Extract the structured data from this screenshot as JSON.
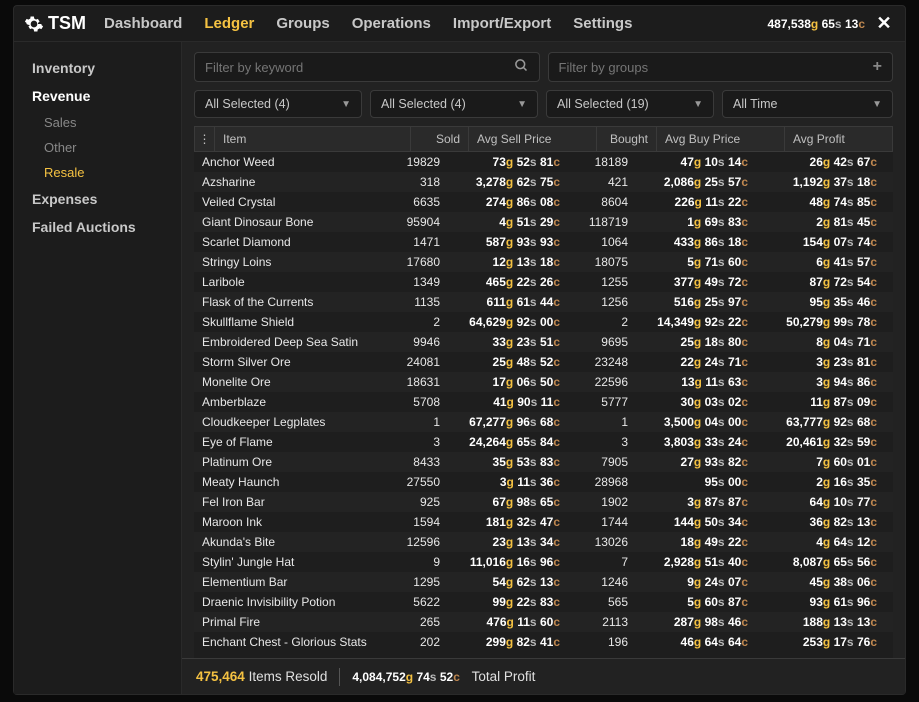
{
  "app": {
    "name": "TSM"
  },
  "nav": {
    "items": [
      "Dashboard",
      "Ledger",
      "Groups",
      "Operations",
      "Import/Export",
      "Settings"
    ],
    "active": "Ledger"
  },
  "wallet": {
    "g": "487,538",
    "s": "65",
    "c": "13"
  },
  "sidebar": {
    "items": [
      {
        "label": "Inventory",
        "type": "top"
      },
      {
        "label": "Revenue",
        "type": "top",
        "sel": true
      },
      {
        "label": "Sales",
        "type": "sub"
      },
      {
        "label": "Other",
        "type": "sub"
      },
      {
        "label": "Resale",
        "type": "sub",
        "sel": true
      },
      {
        "label": "Expenses",
        "type": "top"
      },
      {
        "label": "Failed Auctions",
        "type": "top"
      }
    ]
  },
  "filters": {
    "keyword_placeholder": "Filter by keyword",
    "groups_placeholder": "Filter by groups",
    "dd1": "All Selected (4)",
    "dd2": "All Selected (4)",
    "dd3": "All Selected (19)",
    "dd4": "All Time"
  },
  "columns": [
    "Item",
    "Sold",
    "Avg Sell Price",
    "Bought",
    "Avg Buy Price",
    "Avg Profit"
  ],
  "rows": [
    {
      "item": "Anchor Weed",
      "q": "q2",
      "sold": "19829",
      "asp": {
        "g": "73",
        "s": "52",
        "c": "81"
      },
      "bought": "18189",
      "abp": {
        "g": "47",
        "s": "10",
        "c": "14"
      },
      "prof": {
        "g": "26",
        "s": "42",
        "c": "67"
      }
    },
    {
      "item": "Azsharine",
      "q": "q4",
      "sold": "318",
      "asp": {
        "g": "3,278",
        "s": "62",
        "c": "75"
      },
      "bought": "421",
      "abp": {
        "g": "2,086",
        "s": "25",
        "c": "57"
      },
      "prof": {
        "g": "1,192",
        "s": "37",
        "c": "18"
      }
    },
    {
      "item": "Veiled Crystal",
      "q": "q4",
      "sold": "6635",
      "asp": {
        "g": "274",
        "s": "86",
        "c": "08"
      },
      "bought": "8604",
      "abp": {
        "g": "226",
        "s": "11",
        "c": "22"
      },
      "prof": {
        "g": "48",
        "s": "74",
        "c": "85"
      }
    },
    {
      "item": "Giant Dinosaur Bone",
      "q": "q1",
      "sold": "95904",
      "asp": {
        "g": "4",
        "s": "51",
        "c": "29"
      },
      "bought": "118719",
      "abp": {
        "g": "1",
        "s": "69",
        "c": "83"
      },
      "prof": {
        "g": "2",
        "s": "81",
        "c": "45"
      }
    },
    {
      "item": "Scarlet Diamond",
      "q": "q3",
      "sold": "1471",
      "asp": {
        "g": "587",
        "s": "93",
        "c": "93"
      },
      "bought": "1064",
      "abp": {
        "g": "433",
        "s": "86",
        "c": "18"
      },
      "prof": {
        "g": "154",
        "s": "07",
        "c": "74"
      }
    },
    {
      "item": "Stringy Loins",
      "q": "q1",
      "sold": "17680",
      "asp": {
        "g": "12",
        "s": "13",
        "c": "18"
      },
      "bought": "18075",
      "abp": {
        "g": "5",
        "s": "71",
        "c": "60"
      },
      "prof": {
        "g": "6",
        "s": "41",
        "c": "57"
      }
    },
    {
      "item": "Laribole",
      "q": "q3",
      "sold": "1349",
      "asp": {
        "g": "465",
        "s": "22",
        "c": "26"
      },
      "bought": "1255",
      "abp": {
        "g": "377",
        "s": "49",
        "c": "72"
      },
      "prof": {
        "g": "87",
        "s": "72",
        "c": "54"
      }
    },
    {
      "item": "Flask of the Currents",
      "q": "q1",
      "sold": "1135",
      "asp": {
        "g": "611",
        "s": "61",
        "c": "44"
      },
      "bought": "1256",
      "abp": {
        "g": "516",
        "s": "25",
        "c": "97"
      },
      "prof": {
        "g": "95",
        "s": "35",
        "c": "46"
      }
    },
    {
      "item": "Skullflame Shield",
      "q": "q4",
      "sold": "2",
      "asp": {
        "g": "64,629",
        "s": "92",
        "c": "00"
      },
      "bought": "2",
      "abp": {
        "g": "14,349",
        "s": "92",
        "c": "22"
      },
      "prof": {
        "g": "50,279",
        "s": "99",
        "c": "78"
      }
    },
    {
      "item": "Embroidered Deep Sea Satin",
      "q": "q3",
      "sold": "9946",
      "asp": {
        "g": "33",
        "s": "23",
        "c": "51"
      },
      "bought": "9695",
      "abp": {
        "g": "25",
        "s": "18",
        "c": "80"
      },
      "prof": {
        "g": "8",
        "s": "04",
        "c": "71"
      }
    },
    {
      "item": "Storm Silver Ore",
      "q": "q1",
      "sold": "24081",
      "asp": {
        "g": "25",
        "s": "48",
        "c": "52"
      },
      "bought": "23248",
      "abp": {
        "g": "22",
        "s": "24",
        "c": "71"
      },
      "prof": {
        "g": "3",
        "s": "23",
        "c": "81"
      }
    },
    {
      "item": "Monelite Ore",
      "q": "q1",
      "sold": "18631",
      "asp": {
        "g": "17",
        "s": "06",
        "c": "50"
      },
      "bought": "22596",
      "abp": {
        "g": "13",
        "s": "11",
        "c": "63"
      },
      "prof": {
        "g": "3",
        "s": "94",
        "c": "86"
      }
    },
    {
      "item": "Amberblaze",
      "q": "q3",
      "sold": "5708",
      "asp": {
        "g": "41",
        "s": "90",
        "c": "11"
      },
      "bought": "5777",
      "abp": {
        "g": "30",
        "s": "03",
        "c": "02"
      },
      "prof": {
        "g": "11",
        "s": "87",
        "c": "09"
      }
    },
    {
      "item": "Cloudkeeper Legplates",
      "q": "q4",
      "sold": "1",
      "asp": {
        "g": "67,277",
        "s": "96",
        "c": "68"
      },
      "bought": "1",
      "abp": {
        "g": "3,500",
        "s": "04",
        "c": "00"
      },
      "prof": {
        "g": "63,777",
        "s": "92",
        "c": "68"
      }
    },
    {
      "item": "Eye of Flame",
      "q": "q4",
      "sold": "3",
      "asp": {
        "g": "24,264",
        "s": "65",
        "c": "84"
      },
      "bought": "3",
      "abp": {
        "g": "3,803",
        "s": "33",
        "c": "24"
      },
      "prof": {
        "g": "20,461",
        "s": "32",
        "c": "59"
      }
    },
    {
      "item": "Platinum Ore",
      "q": "q2",
      "sold": "8433",
      "asp": {
        "g": "35",
        "s": "53",
        "c": "83"
      },
      "bought": "7905",
      "abp": {
        "g": "27",
        "s": "93",
        "c": "82"
      },
      "prof": {
        "g": "7",
        "s": "60",
        "c": "01"
      }
    },
    {
      "item": "Meaty Haunch",
      "q": "q1",
      "sold": "27550",
      "asp": {
        "g": "3",
        "s": "11",
        "c": "36"
      },
      "bought": "28968",
      "abp": {
        "g": "",
        "s": "95",
        "c": "00"
      },
      "prof": {
        "g": "2",
        "s": "16",
        "c": "35"
      }
    },
    {
      "item": "Fel Iron Bar",
      "q": "q1",
      "sold": "925",
      "asp": {
        "g": "67",
        "s": "98",
        "c": "65"
      },
      "bought": "1902",
      "abp": {
        "g": "3",
        "s": "87",
        "c": "87"
      },
      "prof": {
        "g": "64",
        "s": "10",
        "c": "77"
      }
    },
    {
      "item": "Maroon Ink",
      "q": "q1",
      "sold": "1594",
      "asp": {
        "g": "181",
        "s": "32",
        "c": "47"
      },
      "bought": "1744",
      "abp": {
        "g": "144",
        "s": "50",
        "c": "34"
      },
      "prof": {
        "g": "36",
        "s": "82",
        "c": "13"
      }
    },
    {
      "item": "Akunda's Bite",
      "q": "q1",
      "sold": "12596",
      "asp": {
        "g": "23",
        "s": "13",
        "c": "34"
      },
      "bought": "13026",
      "abp": {
        "g": "18",
        "s": "49",
        "c": "22"
      },
      "prof": {
        "g": "4",
        "s": "64",
        "c": "12"
      }
    },
    {
      "item": "Stylin' Jungle Hat",
      "q": "q3",
      "sold": "9",
      "asp": {
        "g": "11,016",
        "s": "16",
        "c": "96"
      },
      "bought": "7",
      "abp": {
        "g": "2,928",
        "s": "51",
        "c": "40"
      },
      "prof": {
        "g": "8,087",
        "s": "65",
        "c": "56"
      }
    },
    {
      "item": "Elementium Bar",
      "q": "q1",
      "sold": "1295",
      "asp": {
        "g": "54",
        "s": "62",
        "c": "13"
      },
      "bought": "1246",
      "abp": {
        "g": "9",
        "s": "24",
        "c": "07"
      },
      "prof": {
        "g": "45",
        "s": "38",
        "c": "06"
      }
    },
    {
      "item": "Draenic Invisibility Potion",
      "q": "q1",
      "sold": "5622",
      "asp": {
        "g": "99",
        "s": "22",
        "c": "83"
      },
      "bought": "565",
      "abp": {
        "g": "5",
        "s": "60",
        "c": "87"
      },
      "prof": {
        "g": "93",
        "s": "61",
        "c": "96"
      }
    },
    {
      "item": "Primal Fire",
      "q": "q2",
      "sold": "265",
      "asp": {
        "g": "476",
        "s": "11",
        "c": "60"
      },
      "bought": "2113",
      "abp": {
        "g": "287",
        "s": "98",
        "c": "46"
      },
      "prof": {
        "g": "188",
        "s": "13",
        "c": "13"
      }
    },
    {
      "item": "Enchant Chest - Glorious Stats",
      "q": "q1",
      "sold": "202",
      "asp": {
        "g": "299",
        "s": "82",
        "c": "41"
      },
      "bought": "196",
      "abp": {
        "g": "46",
        "s": "64",
        "c": "64"
      },
      "prof": {
        "g": "253",
        "s": "17",
        "c": "76"
      }
    }
  ],
  "footer": {
    "resold_count": "475,464",
    "resold_label": "Items Resold",
    "profit_g": "4,084,752",
    "profit_s": "74",
    "profit_c": "52",
    "profit_label": "Total Profit"
  }
}
